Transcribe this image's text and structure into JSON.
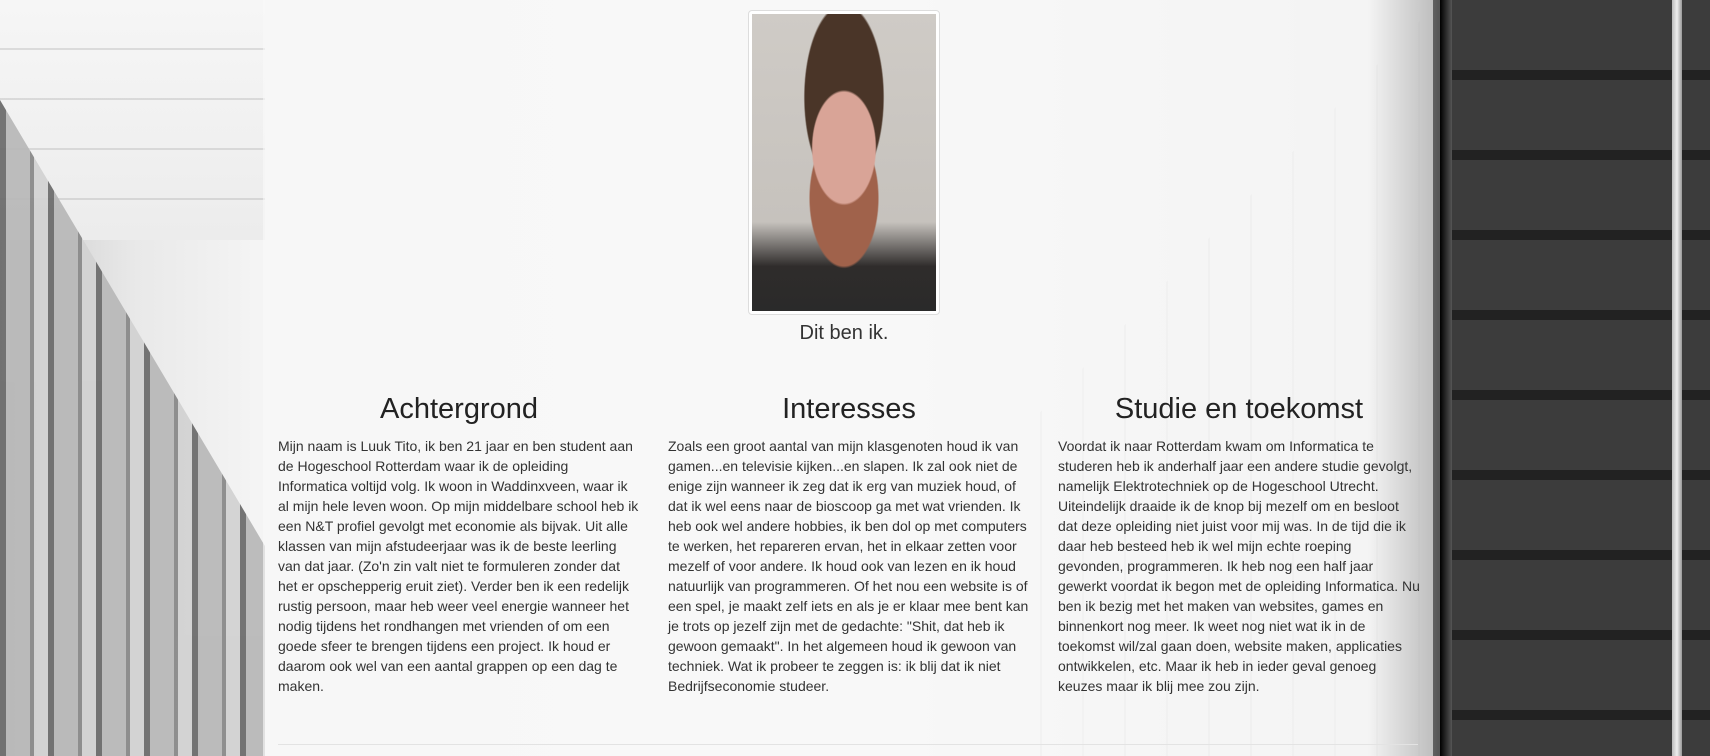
{
  "profile": {
    "caption": "Dit ben ik."
  },
  "sections": [
    {
      "title": "Achtergrond",
      "text": "Mijn naam is Luuk Tito, ik ben 21 jaar en ben student aan de Hogeschool Rotterdam waar ik de opleiding Informatica voltijd volg. Ik woon in Waddinxveen, waar ik al mijn hele leven woon. Op mijn middelbare school heb ik een N&T profiel gevolgt met economie als bijvak. Uit alle klassen van mijn afstudeerjaar was ik de beste leerling van dat jaar. (Zo'n zin valt niet te formuleren zonder dat het er opschepperig eruit ziet). Verder ben ik een redelijk rustig persoon, maar heb weer veel energie wanneer het nodig tijdens het rondhangen met vrienden of om een goede sfeer te brengen tijdens een project. Ik houd er daarom ook wel van een aantal grappen op een dag te maken."
    },
    {
      "title": "Interesses",
      "text": "Zoals een groot aantal van mijn klasgenoten houd ik van gamen...en televisie kijken...en slapen. Ik zal ook niet de enige zijn wanneer ik zeg dat ik erg van muziek houd, of dat ik wel eens naar de bioscoop ga met wat vrienden. Ik heb ook wel andere hobbies, ik ben dol op met computers te werken, het repareren ervan, het in elkaar zetten voor mezelf of voor andere. Ik houd ook van lezen en ik houd natuurlijk van programmeren. Of het nou een website is of een spel, je maakt zelf iets en als je er klaar mee bent kan je trots op jezelf zijn met de gedachte: \"Shit, dat heb ik gewoon gemaakt\". In het algemeen houd ik gewoon van techniek. Wat ik probeer te zeggen is: ik blij dat ik niet Bedrijfseconomie studeer."
    },
    {
      "title": "Studie en toekomst",
      "text": "Voordat ik naar Rotterdam kwam om Informatica te studeren heb ik anderhalf jaar een andere studie gevolgt, namelijk Elektrotechniek op de Hogeschool Utrecht. Uiteindelijk draaide ik de knop bij mezelf om en besloot dat deze opleiding niet juist voor mij was. In de tijd die ik daar heb besteed heb ik wel mijn echte roeping gevonden, programmeren. Ik heb nog een half jaar gewerkt voordat ik begon met de opleiding Informatica. Nu ben ik bezig met het maken van websites, games en binnenkort nog meer. Ik weet nog niet wat ik in de toekomst wil/zal gaan doen, website maken, applicaties ontwikkelen, etc. Maar ik heb in ieder geval genoeg keuzes maar ik blij mee zou zijn."
    }
  ]
}
